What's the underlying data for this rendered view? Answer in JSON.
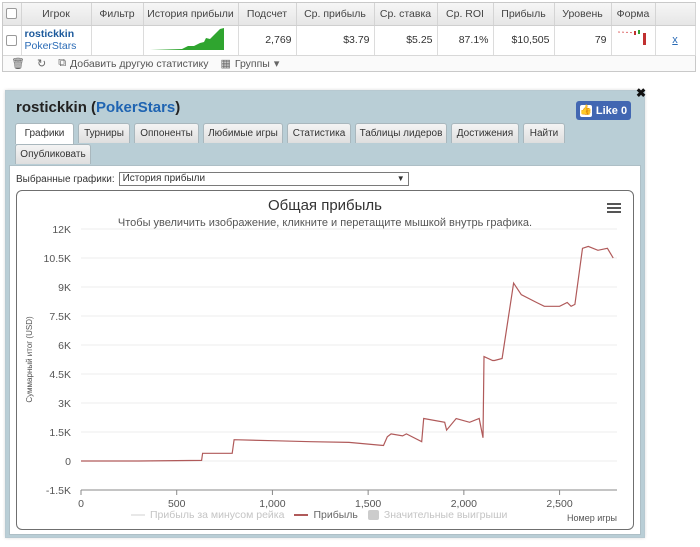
{
  "stats": {
    "headers": [
      "",
      "Игрок",
      "Фильтр",
      "История прибыли",
      "Подсчет",
      "Ср. прибыль",
      "Ср. ставка",
      "Ср. ROI",
      "Прибыль",
      "Уровень",
      "Форма",
      ""
    ],
    "row": {
      "player_name": "rostickkin",
      "player_site": "PokerStars",
      "filter": "",
      "count": "2,769",
      "avg_profit": "$3.79",
      "avg_stake": "$5.25",
      "avg_roi": "87.1%",
      "profit": "$10,505",
      "level": "79",
      "remove": "x"
    },
    "toolbar": {
      "add_stats": "Добавить другую статистику",
      "groups": "Группы"
    }
  },
  "panel": {
    "player_name": "rostickkin",
    "site": "PokerStars",
    "like_label": "Like 0",
    "tabs": [
      "Графики",
      "Турниры",
      "Оппоненты",
      "Любимые игры",
      "Статистика",
      "Таблицы лидеров",
      "Достижения",
      "Найти",
      "Опубликовать"
    ],
    "selected_label": "Выбранные графики:",
    "selected_value": "История прибыли"
  },
  "colors": {
    "profit_line": "#b05a5a",
    "rake_line": "#e8e8e8",
    "big_wins": "#c8c8c8",
    "sparkline": "#2fa52f",
    "panel_bg": "#b9ced6",
    "link": "#1f64b2",
    "like_bg": "#4267b2"
  },
  "icons": {
    "trash": "trash-icon",
    "refresh": "refresh-icon",
    "copy": "copy-icon",
    "groups": "groups-icon",
    "menu": "hamburger-menu-icon",
    "close": "close-icon"
  },
  "chart_data": {
    "type": "line",
    "title": "Общая прибыль",
    "subtitle": "Чтобы увеличить изображение, кликните и перетащите мышкой внутрь графика.",
    "xlabel": "Номер игры",
    "ylabel": "Суммарный итог (USD)",
    "xlim": [
      0,
      2800
    ],
    "ylim": [
      -1500,
      12000
    ],
    "x_ticks": [
      0,
      500,
      1000,
      1500,
      2000,
      2500
    ],
    "x_tick_labels": [
      "0",
      "500",
      "1,000",
      "1,500",
      "2,000",
      "2,500"
    ],
    "y_ticks": [
      -1500,
      0,
      1500,
      3000,
      4500,
      6000,
      7500,
      9000,
      10500,
      12000
    ],
    "y_tick_labels": [
      "-1.5K",
      "0",
      "1.5K",
      "3K",
      "4.5K",
      "6K",
      "7.5K",
      "9K",
      "10.5K",
      "12K"
    ],
    "legend": [
      "Прибыль за минусом рейка",
      "Прибыль",
      "Значительные выигрыши"
    ],
    "series": [
      {
        "name": "Прибыль",
        "x": [
          0,
          300,
          500,
          630,
          635,
          790,
          800,
          1000,
          1200,
          1400,
          1580,
          1600,
          1620,
          1680,
          1700,
          1780,
          1790,
          1900,
          1910,
          1960,
          2030,
          2080,
          2100,
          2105,
          2150,
          2160,
          2200,
          2260,
          2300,
          2380,
          2420,
          2500,
          2540,
          2560,
          2580,
          2620,
          2650,
          2700,
          2750,
          2780
        ],
        "y": [
          0,
          0,
          20,
          30,
          400,
          400,
          1100,
          1050,
          1000,
          960,
          800,
          1250,
          1400,
          1300,
          1400,
          1000,
          2200,
          2000,
          1600,
          2200,
          2000,
          2200,
          1200,
          5400,
          5200,
          5200,
          5300,
          9200,
          8600,
          8200,
          8000,
          8000,
          8200,
          8000,
          8100,
          11000,
          11100,
          10900,
          11000,
          10500
        ]
      }
    ]
  }
}
